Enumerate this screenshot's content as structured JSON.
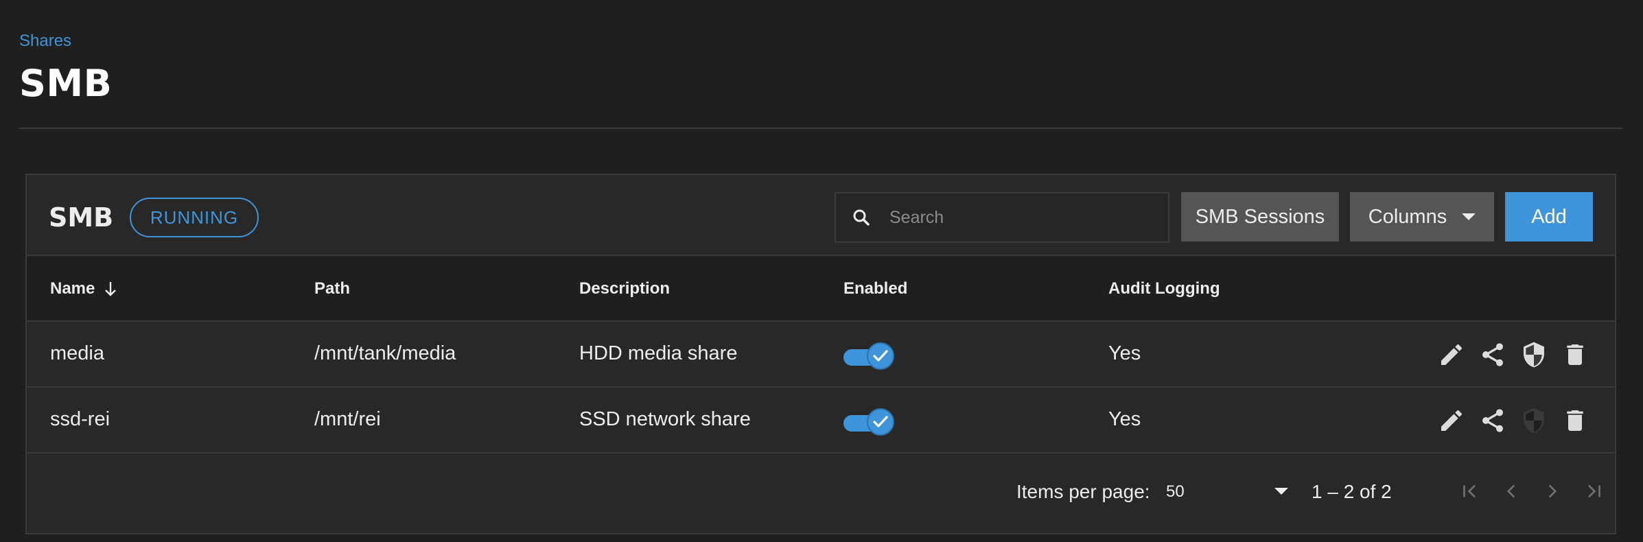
{
  "breadcrumb": {
    "label": "Shares"
  },
  "page": {
    "title": "SMB"
  },
  "card": {
    "title": "SMB",
    "status": "RUNNING",
    "search": {
      "placeholder": "Search",
      "value": ""
    },
    "buttons": {
      "sessions": "SMB Sessions",
      "columns": "Columns",
      "add": "Add"
    }
  },
  "table": {
    "columns": [
      "Name",
      "Path",
      "Description",
      "Enabled",
      "Audit Logging"
    ],
    "sort": {
      "column": "Name",
      "direction": "descending-arrow"
    },
    "rows": [
      {
        "name": "media",
        "path": "/mnt/tank/media",
        "description": "HDD media share",
        "enabled": true,
        "audit_logging": "Yes"
      },
      {
        "name": "ssd-rei",
        "path": "/mnt/rei",
        "description": "SSD network share",
        "enabled": true,
        "audit_logging": "Yes"
      }
    ],
    "row_actions": [
      "edit-icon",
      "share-icon",
      "shield-icon",
      "delete-icon"
    ]
  },
  "paginator": {
    "items_per_page_label": "Items per page:",
    "page_size": "50",
    "range": "1 – 2 of 2"
  },
  "colors": {
    "accent": "#3f95d9",
    "background": "#1f1f1f",
    "card": "#282828",
    "button_secondary": "#555555"
  }
}
